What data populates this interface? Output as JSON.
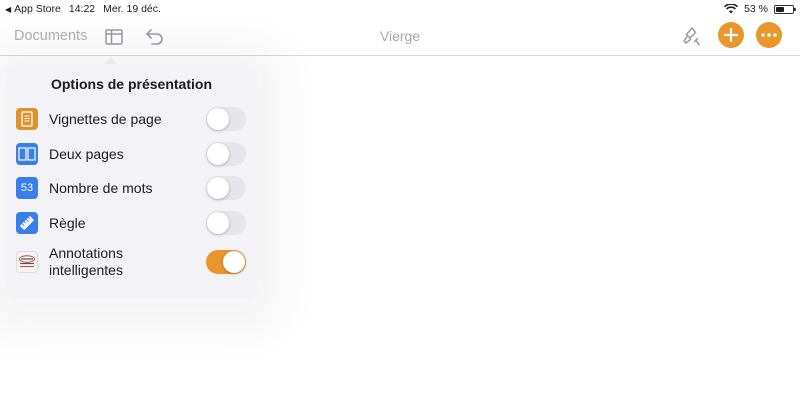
{
  "status_bar": {
    "back_app": "App Store",
    "time": "14:22",
    "date": "Mer. 19 déc.",
    "battery_percent": "53 %",
    "battery_level": 0.53
  },
  "toolbar": {
    "documents_label": "Documents",
    "title": "Vierge",
    "accent_color": "#e9962b"
  },
  "popover": {
    "title": "Options de présentation",
    "options": [
      {
        "label": "Vignettes de page",
        "icon": "page-thumbnails-icon",
        "on": false
      },
      {
        "label": "Deux pages",
        "icon": "two-pages-icon",
        "on": false
      },
      {
        "label": "Nombre de mots",
        "icon": "word-count-icon",
        "icon_text": "53",
        "on": false
      },
      {
        "label": "Règle",
        "icon": "ruler-icon",
        "on": false
      },
      {
        "label": "Annotations\nintelligentes",
        "icon": "smart-annotations-icon",
        "on": true
      }
    ]
  }
}
